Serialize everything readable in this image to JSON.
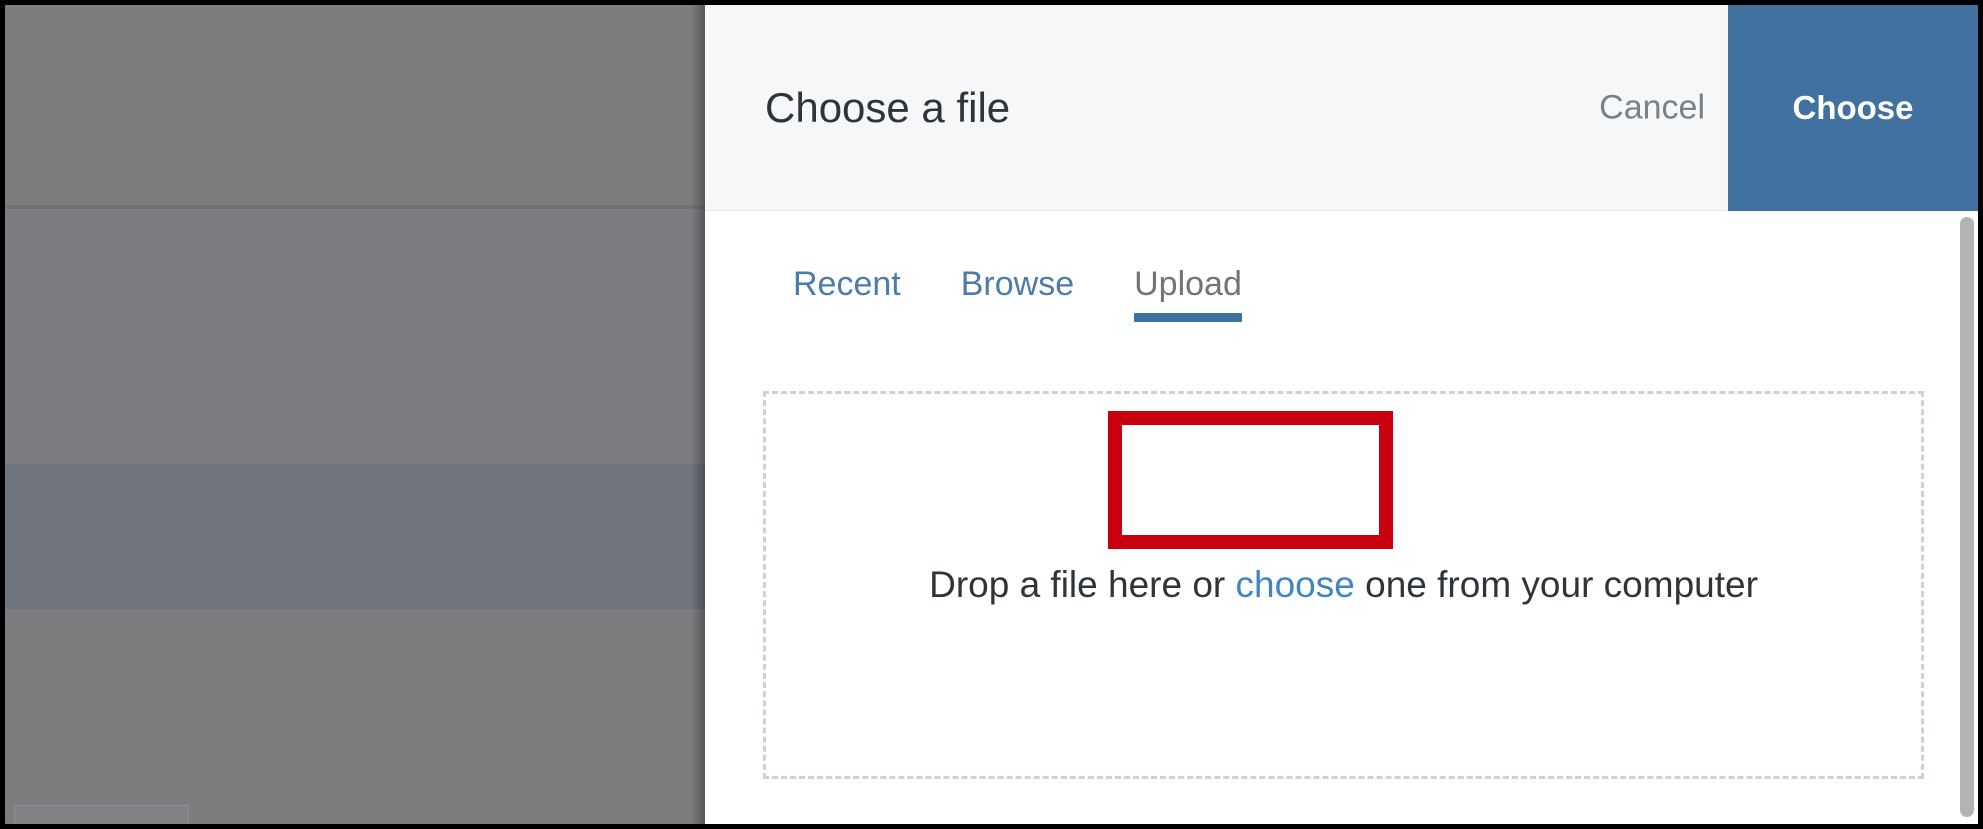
{
  "dialog": {
    "title": "Choose a file",
    "cancel_label": "Cancel",
    "choose_label": "Choose",
    "accent_color": "#41729f",
    "header_background": "#f5f7f9"
  },
  "tabs": [
    {
      "label": "Recent",
      "active": false
    },
    {
      "label": "Browse",
      "active": false
    },
    {
      "label": "Upload",
      "active": true
    }
  ],
  "drop_zone": {
    "text_before_link": "Drop a file here or ",
    "link_label": "choose",
    "text_after_link": " one from your computer",
    "border_color": "#ccd2dc"
  },
  "annotation": {
    "target": "Upload",
    "color": "#c8000e"
  },
  "backdrop": {
    "overlay_color": "#7d7e80"
  },
  "scrollbar": {
    "thumb_color": "#b3b3b3"
  }
}
